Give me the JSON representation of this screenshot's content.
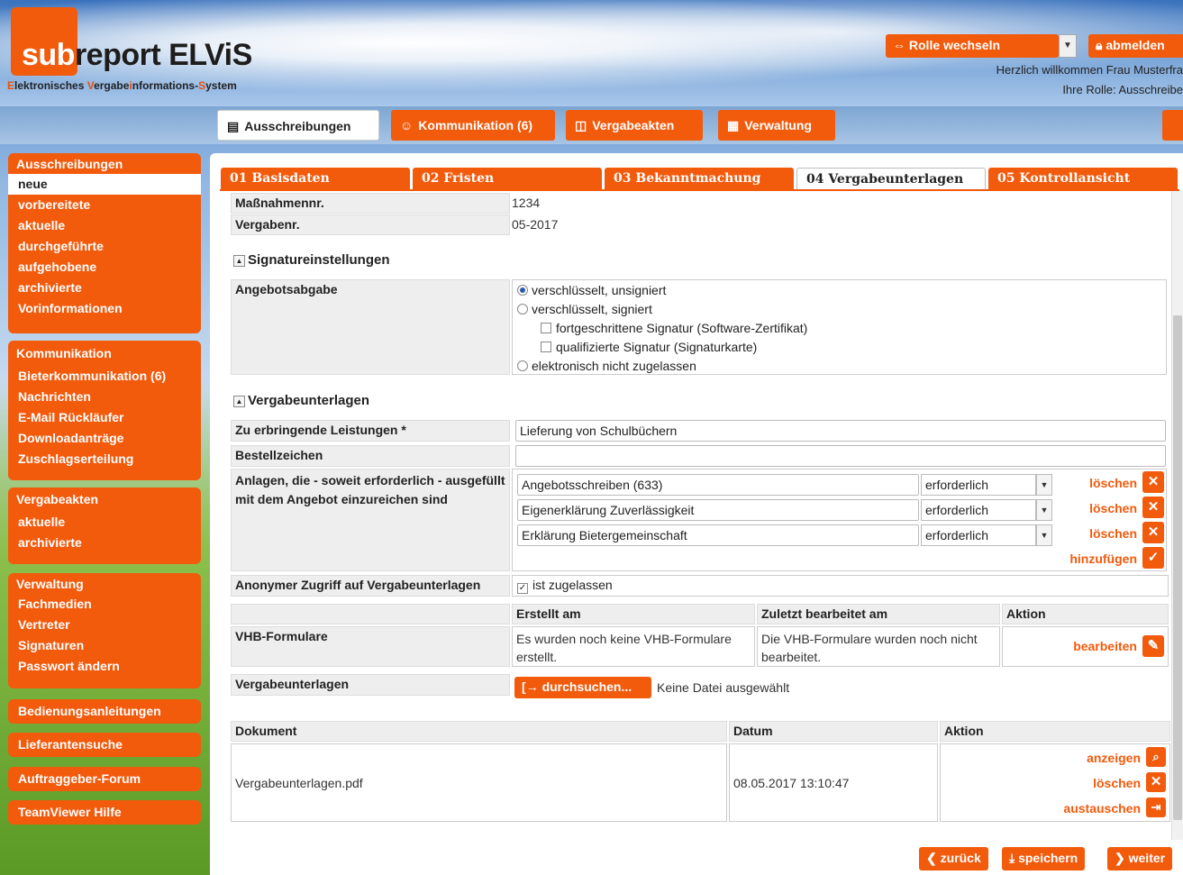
{
  "header": {
    "logo_sub": "sub",
    "logo_main": "report ELViS",
    "tagline_parts": [
      "E",
      "lektronisches ",
      "V",
      "ergabe",
      "i",
      "nformations-",
      "S",
      "ystem"
    ],
    "role_switch_label": "Rolle wechseln",
    "logout_label": "abmelden",
    "welcome": "Herzlich willkommen Frau Musterfra",
    "role_line": "Ihre Rolle: Ausschreibe"
  },
  "topnav": {
    "tabs": [
      {
        "label": "Ausschreibungen",
        "icon": "list-icon"
      },
      {
        "label": "Kommunikation (6)",
        "icon": "person-chat-icon"
      },
      {
        "label": "Vergabeakten",
        "icon": "box-icon"
      },
      {
        "label": "Verwaltung",
        "icon": "calendar-grid-icon"
      }
    ]
  },
  "sidebar": {
    "ausschreibungen": {
      "title": "Ausschreibungen",
      "items": [
        "neue",
        "vorbereitete",
        "aktuelle",
        "durchgeführte",
        "aufgehobene",
        "archivierte",
        "Vorinformationen"
      ]
    },
    "kommunikation": {
      "title": "Kommunikation",
      "items": [
        "Bieterkommunikation (6)",
        "Nachrichten",
        "E-Mail Rückläufer",
        "Downloadanträge",
        "Zuschlagserteilung"
      ]
    },
    "vergabeakten": {
      "title": "Vergabeakten",
      "items": [
        "aktuelle",
        "archivierte"
      ]
    },
    "verwaltung": {
      "title": "Verwaltung",
      "items": [
        "Fachmedien",
        "Vertreter",
        "Signaturen",
        "Passwort ändern"
      ]
    },
    "single": [
      "Bedienungsanleitungen",
      "Lieferantensuche",
      "Auftraggeber-Forum",
      "TeamViewer Hilfe"
    ]
  },
  "steps": [
    "01 Basisdaten",
    "02 Fristen",
    "03 Bekanntmachung",
    "04 Vergabeunterlagen",
    "05 Kontrollansicht"
  ],
  "form": {
    "massnahme_label": "Maßnahmennr.",
    "massnahme_value": "1234",
    "vergabenr_label": "Vergabenr.",
    "vergabenr_value": "05-2017",
    "signatur_section": "Signatureinstellungen",
    "angebotsabgabe_label": "Angebotsabgabe",
    "angebot_options": {
      "opt1": "verschlüsselt, unsigniert",
      "opt2": "verschlüsselt, signiert",
      "sub1": "fortgeschrittene Signatur (Software-Zertifikat)",
      "sub2": "qualifizierte Signatur (Signaturkarte)",
      "opt3": "elektronisch nicht zugelassen"
    },
    "vergabeunterlagen_section": "Vergabeunterlagen",
    "leistungen_label": "Zu erbringende Leistungen *",
    "leistungen_value": "Lieferung von Schulbüchern",
    "bestellzeichen_label": "Bestellzeichen",
    "bestellzeichen_value": "",
    "anlagen_label": "Anlagen, die - soweit erforderlich - ausgefüllt mit dem Angebot einzureichen sind",
    "anlagen": [
      {
        "name": "Angebotsschreiben (633)",
        "status": "erforderlich"
      },
      {
        "name": "Eigenerklärung Zuverlässigkeit",
        "status": "erforderlich"
      },
      {
        "name": "Erklärung Bietergemeinschaft",
        "status": "erforderlich"
      }
    ],
    "delete_label": "löschen",
    "add_label": "hinzufügen",
    "anonym_label": "Anonymer Zugriff auf Vergabeunterlagen",
    "anonym_value": "ist zugelassen",
    "vhb_headers": [
      "Erstellt am",
      "Zuletzt bearbeitet am",
      "Aktion"
    ],
    "vhb_label": "VHB-Formulare",
    "vhb_created": "Es wurden noch keine VHB-Formulare erstellt.",
    "vhb_edited": "Die VHB-Formulare wurden noch nicht bearbeitet.",
    "vhb_action": "bearbeiten",
    "upload_label": "Vergabeunterlagen",
    "browse_label": "durchsuchen...",
    "no_file": "Keine Datei ausgewählt",
    "doc_headers": [
      "Dokument",
      "Datum",
      "Aktion"
    ],
    "doc_name": "Vergabeunterlagen.pdf",
    "doc_date": "08.05.2017 13:10:47",
    "doc_actions": [
      "anzeigen",
      "löschen",
      "austauschen"
    ]
  },
  "footer": {
    "back": "zurück",
    "save": "speichern",
    "next": "weiter"
  },
  "colors": {
    "accent": "#f25a0c"
  }
}
